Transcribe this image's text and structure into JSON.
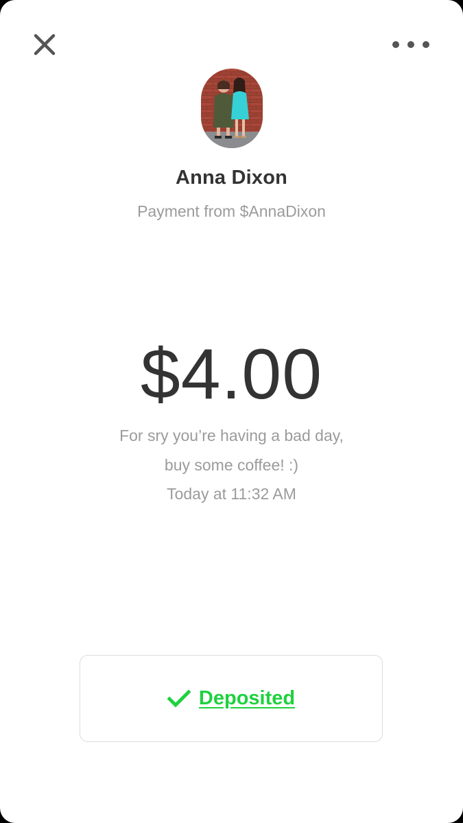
{
  "header": {
    "close_icon": "close-icon",
    "more_icon": "more-horizontal-icon"
  },
  "payer": {
    "name": "Anna Dixon",
    "subtitle": "Payment from $AnnaDixon"
  },
  "payment": {
    "amount": "$4.00",
    "note": "For sry you’re having a bad day, buy some coffee! :)",
    "timestamp": "Today at 11:32 AM"
  },
  "status": {
    "label": "Deposited",
    "icon": "checkmark-icon",
    "color": "#1ed13e"
  }
}
